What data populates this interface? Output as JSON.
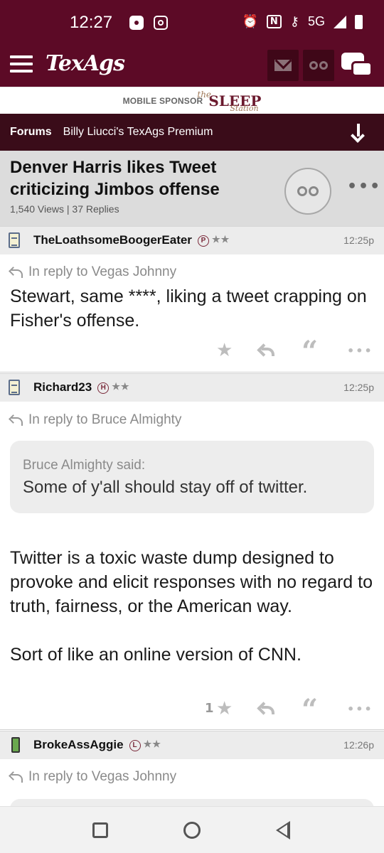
{
  "status_bar": {
    "time": "12:27",
    "network": "5G"
  },
  "header": {
    "logo_text": "TexAgs"
  },
  "sponsor": {
    "label": "MOBILE SPONSOR",
    "brand_small": "the",
    "brand": "SLEEP",
    "brand_sub": "Station"
  },
  "breadcrumb": {
    "forums": "Forums",
    "board": "Billy Liucci's TexAgs Premium"
  },
  "thread": {
    "title": "Denver Harris likes Tweet criticizing Jimbos offense",
    "meta": "1,540 Views | 37 Replies"
  },
  "posts": [
    {
      "username": "TheLoathsomeBoogerEater",
      "badge": "P",
      "stars": "★★",
      "time": "12:25p",
      "reply_to": "In reply to Vegas Johnny",
      "body": "Stewart, same ****, liking a tweet crapping on Fisher's offense.",
      "star_count": ""
    },
    {
      "username": "Richard23",
      "badge": "H",
      "stars": "★★",
      "time": "12:25p",
      "reply_to": "In reply to Bruce Almighty",
      "quote_author": "Bruce Almighty said:",
      "quote_text": "Some of y'all should stay off of twitter.",
      "body": "Twitter is a toxic waste dump designed to provoke and elicit responses with no regard to truth, fairness, or the American way.\n\nSort of like an online version of CNN.",
      "star_count": "1"
    },
    {
      "username": "BrokeAssAggie",
      "badge": "L",
      "stars": "★★",
      "time": "12:26p",
      "reply_to": "In reply to Vegas Johnny"
    }
  ],
  "icons": {
    "star": "★",
    "quote": "“",
    "more": "•••"
  },
  "colors": {
    "brand_maroon": "#5c0a26",
    "breadcrumb_bg": "#3a0c19"
  }
}
